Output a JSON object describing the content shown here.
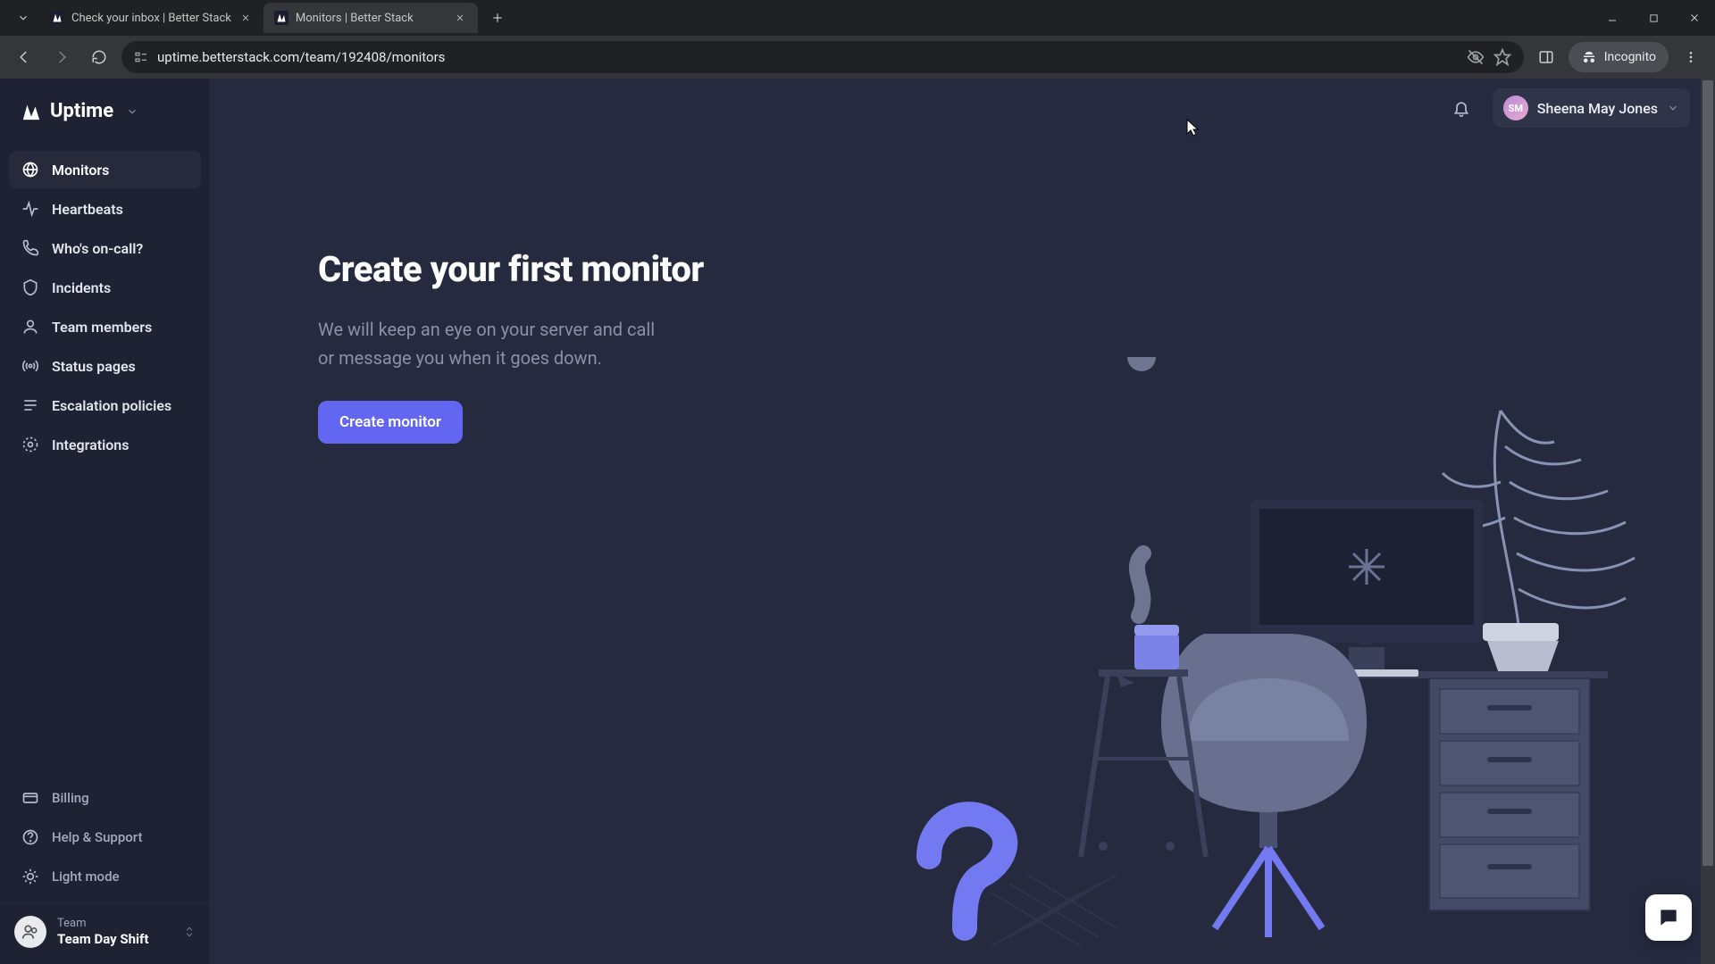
{
  "browser": {
    "tabs": [
      {
        "title": "Check your inbox | Better Stack"
      },
      {
        "title": "Monitors | Better Stack"
      }
    ],
    "url": "uptime.betterstack.com/team/192408/monitors",
    "incognito_label": "Incognito"
  },
  "brand": {
    "name": "Uptime"
  },
  "sidebar": {
    "items": [
      {
        "label": "Monitors",
        "icon": "globe"
      },
      {
        "label": "Heartbeats",
        "icon": "activity"
      },
      {
        "label": "Who's on-call?",
        "icon": "phone"
      },
      {
        "label": "Incidents",
        "icon": "shield"
      },
      {
        "label": "Team members",
        "icon": "user"
      },
      {
        "label": "Status pages",
        "icon": "broadcast"
      },
      {
        "label": "Escalation policies",
        "icon": "list"
      },
      {
        "label": "Integrations",
        "icon": "gear-ring"
      }
    ],
    "bottom_items": [
      {
        "label": "Billing",
        "icon": "credit-card"
      },
      {
        "label": "Help & Support",
        "icon": "help"
      },
      {
        "label": "Light mode",
        "icon": "sun"
      }
    ]
  },
  "team": {
    "header_label": "Team",
    "name": "Team Day Shift"
  },
  "user": {
    "initials": "SM",
    "full_name": "Sheena May Jones"
  },
  "hero": {
    "title": "Create your first monitor",
    "subtitle": "We will keep an eye on your server and call or message you when it goes down.",
    "cta": "Create monitor"
  }
}
